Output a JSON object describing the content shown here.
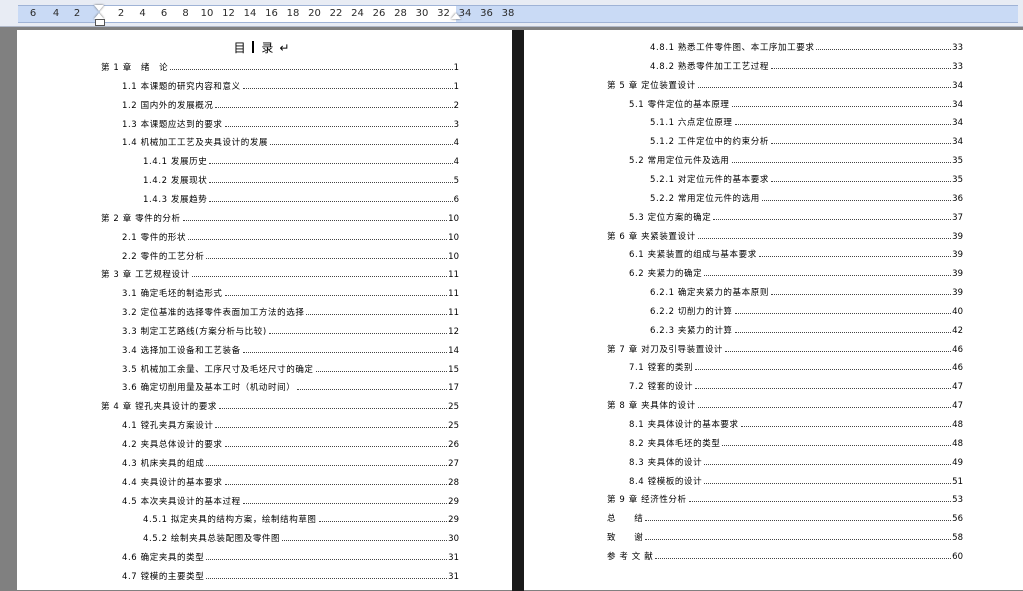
{
  "ruler": {
    "left_ticks": [
      "6",
      "4",
      "2"
    ],
    "right_ticks": [
      "2",
      "4",
      "6",
      "8",
      "10",
      "12",
      "14",
      "16",
      "18",
      "20",
      "22",
      "24",
      "26",
      "28",
      "30",
      "32",
      "34",
      "36",
      "38"
    ]
  },
  "toc_title": "目   录↵",
  "left_page": [
    {
      "level": 1,
      "text": "第 1 章　绪　论",
      "page": "1"
    },
    {
      "level": 2,
      "text": "1.1 本课题的研究内容和意义",
      "page": "1"
    },
    {
      "level": 2,
      "text": "1.2  国内外的发展概况",
      "page": "2"
    },
    {
      "level": 2,
      "text": "1.3  本课题应达到的要求",
      "page": "3"
    },
    {
      "level": 2,
      "text": "1.4  机械加工工艺及夹具设计的发展",
      "page": "4"
    },
    {
      "level": 3,
      "text": "1.4.1  发展历史",
      "page": "4"
    },
    {
      "level": 3,
      "text": "1.4.2 发展现状",
      "page": "5"
    },
    {
      "level": 3,
      "text": "1.4.3 发展趋势",
      "page": "6"
    },
    {
      "level": 1,
      "text": "第 2 章  零件的分析",
      "page": "10"
    },
    {
      "level": 2,
      "text": "2.1 零件的形状",
      "page": "10"
    },
    {
      "level": 2,
      "text": "2.2 零件的工艺分析",
      "page": "10"
    },
    {
      "level": 1,
      "text": "第 3 章  工艺规程设计",
      "page": "11"
    },
    {
      "level": 2,
      "text": "3.1  确定毛坯的制造形式",
      "page": "11"
    },
    {
      "level": 2,
      "text": "3.2 定位基准的选择零件表面加工方法的选择",
      "page": "11"
    },
    {
      "level": 2,
      "text": "3.3  制定工艺路线(方案分析与比较)",
      "page": "12"
    },
    {
      "level": 2,
      "text": "3.4  选择加工设备和工艺装备",
      "page": "14"
    },
    {
      "level": 2,
      "text": "3.5  机械加工余量、工序尺寸及毛坯尺寸的确定",
      "page": "15"
    },
    {
      "level": 2,
      "text": "3.6 确定切削用量及基本工时（机动时间）",
      "page": "17"
    },
    {
      "level": 1,
      "text": "第 4 章    镗孔夹具设计的要求",
      "page": "25"
    },
    {
      "level": 2,
      "text": "4.1  镗孔夹具方案设计",
      "page": "25"
    },
    {
      "level": 2,
      "text": "4.2 夹具总体设计的要求",
      "page": "26"
    },
    {
      "level": 2,
      "text": "4.3  机床夹具的组成",
      "page": "27"
    },
    {
      "level": 2,
      "text": "4.4  夹具设计的基本要求",
      "page": "28"
    },
    {
      "level": 2,
      "text": "4.5  本次夹具设计的基本过程",
      "page": "29"
    },
    {
      "level": 3,
      "text": "4.5.1  拟定夹具的结构方案，绘制结构草图",
      "page": "29"
    },
    {
      "level": 3,
      "text": "4.5.2  绘制夹具总装配图及零件图",
      "page": "30"
    },
    {
      "level": 2,
      "text": "4.6  确定夹具的类型",
      "page": "31"
    },
    {
      "level": 2,
      "text": "4.7  镗模的主要类型",
      "page": "31"
    }
  ],
  "right_page": [
    {
      "level": 3,
      "text": "4.8.1  熟悉工件零件图、本工序加工要求",
      "page": "33"
    },
    {
      "level": 3,
      "text": "4.8.2  熟悉零件加工工艺过程",
      "page": "33"
    },
    {
      "level": 1,
      "text": "第 5 章  定位装置设计",
      "page": "34"
    },
    {
      "level": 2,
      "text": "5.1  零件定位的基本原理",
      "page": "34"
    },
    {
      "level": 3,
      "text": "5.1.1  六点定位原理",
      "page": "34"
    },
    {
      "level": 3,
      "text": "5.1.2  工件定位中的约束分析",
      "page": "34"
    },
    {
      "level": 2,
      "text": "5.2  常用定位元件及选用",
      "page": "35"
    },
    {
      "level": 3,
      "text": "5.2.1  对定位元件的基本要求",
      "page": "35"
    },
    {
      "level": 3,
      "text": "5.2.2  常用定位元件的选用",
      "page": "36"
    },
    {
      "level": 2,
      "text": "5.3  定位方案的确定",
      "page": "37"
    },
    {
      "level": 1,
      "text": "第 6 章  夹紧装置设计",
      "page": "39"
    },
    {
      "level": 2,
      "text": "6.1  夹紧装置的组成与基本要求",
      "page": "39"
    },
    {
      "level": 2,
      "text": "6.2  夹紧力的确定",
      "page": "39"
    },
    {
      "level": 3,
      "text": "6.2.1  确定夹紧力的基本原则",
      "page": "39"
    },
    {
      "level": 3,
      "text": "6.2.2  切削力的计算",
      "page": "40"
    },
    {
      "level": 3,
      "text": "6.2.3  夹紧力的计算",
      "page": "42"
    },
    {
      "level": 1,
      "text": "第 7 章  对刀及引导装置设计",
      "page": "46"
    },
    {
      "level": 2,
      "text": "7.1  镗套的类别",
      "page": "46"
    },
    {
      "level": 2,
      "text": "7.2  镗套的设计",
      "page": "47"
    },
    {
      "level": 1,
      "text": "第 8 章  夹具体的设计",
      "page": "47"
    },
    {
      "level": 2,
      "text": "8.1  夹具体设计的基本要求",
      "page": "48"
    },
    {
      "level": 2,
      "text": "8.2  夹具体毛坯的类型",
      "page": "48"
    },
    {
      "level": 2,
      "text": "8.3  夹具体的设计",
      "page": "49"
    },
    {
      "level": 2,
      "text": "8.4  镗模板的设计",
      "page": "51"
    },
    {
      "level": 1,
      "text": "第 9 章    经济性分析",
      "page": "53"
    },
    {
      "level": 1,
      "text": "总　　结",
      "page": "56"
    },
    {
      "level": 1,
      "text": "致　　谢",
      "page": "58"
    },
    {
      "level": 1,
      "text": "参 考 文 献",
      "page": "60"
    }
  ]
}
